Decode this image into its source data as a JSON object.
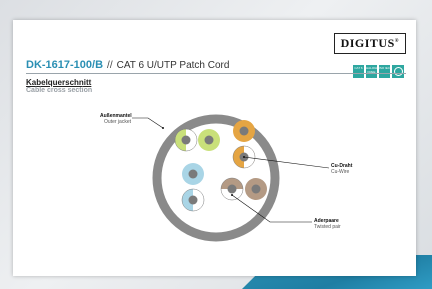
{
  "header": {
    "sku": "DK-1617-100/B",
    "separator": "//",
    "product": "CAT 6 U/UTP Patch Cord",
    "logo": "DIGITUS"
  },
  "section": {
    "title_de": "Kabelquerschnitt",
    "title_en": "Cable cross section"
  },
  "certifications": [
    {
      "icon": "cat6-badge",
      "text": "CAT 6"
    },
    {
      "icon": "halogen-free-badge",
      "text": "HALOGEN FREE"
    },
    {
      "icon": "iso-iec-badge",
      "text": "ISO IEC"
    },
    {
      "icon": "round-seal-badge",
      "text": ""
    }
  ],
  "labels": {
    "outer_jacket": {
      "de": "Außenmantel",
      "en": "Outer jacket"
    },
    "cu_wire": {
      "de": "Cu-Draht",
      "en": "Cu-Wire"
    },
    "twisted_pair": {
      "de": "Aderpaare",
      "en": "Twisted pair"
    }
  },
  "colors": {
    "jacket": "#8a8a8a",
    "green": "#c9e07a",
    "orange": "#e5a543",
    "blue": "#a9d5e6",
    "brown": "#b49a84",
    "brand": "#2a8fb3",
    "cert": "#2ea7a0"
  }
}
